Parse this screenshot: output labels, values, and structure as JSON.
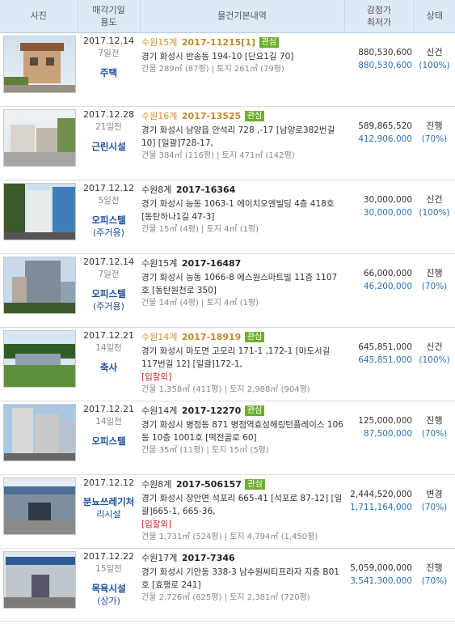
{
  "headers": {
    "photo": "사진",
    "date_line1": "매각기일",
    "date_line2": "용도",
    "info": "물건기본내역",
    "price_line1": "감정가",
    "price_line2": "최저가",
    "status": "상태"
  },
  "colors": {
    "header_bg": "#dde9f5",
    "interest_badge": "#6fae2f",
    "case_highlight": "#c28a2a",
    "use_blue": "#1a4fa0",
    "min_price_blue": "#2a72b8",
    "warning_red": "#d42020"
  },
  "rows": [
    {
      "date": "2017.12.14",
      "days": "7일전",
      "use": "주택",
      "use2": "",
      "court": "수원15계",
      "case_no": "2017-11215[1]",
      "highlight": true,
      "badge": "관심",
      "address": "경기 화성시 반송동 194-10 [단요1길 70]",
      "tag": "",
      "building": "건물 289㎡ (87평) | 토지 261㎡ (79평)",
      "appraisal": "880,530,600",
      "minimum": "880,530,600",
      "status": "신건",
      "ratio": "(100%)",
      "photo_icon": "house-photo"
    },
    {
      "date": "2017.12.28",
      "days": "21일전",
      "use": "근린시설",
      "use2": "",
      "court": "수원16계",
      "case_no": "2017-13525",
      "highlight": true,
      "badge": "관심",
      "address": "경기 화성시 남양읍 안석리 728 ,-17 [남양로382번길 10] [일괄]728-17,",
      "tag": "",
      "building": "건물 384㎡ (116평) | 토지 471㎡ (142평)",
      "appraisal": "589,865,520",
      "minimum": "412,906,000",
      "status": "진행",
      "ratio": "(70%)",
      "photo_icon": "street-photo"
    },
    {
      "date": "2017.12.12",
      "days": "5일전",
      "use": "오피스텔",
      "use2": "(주거용)",
      "court": "수원8계",
      "case_no": "2017-16364",
      "highlight": false,
      "badge": "",
      "address": "경기 화성시 능동 1063-1 에이치오엔빌딩 4층 418호 [동탄하나1길 47-3]",
      "tag": "",
      "building": "건물 15㎡ (4평) | 토지 4㎡ (1평)",
      "appraisal": "30,000,000",
      "minimum": "30,000,000",
      "status": "신건",
      "ratio": "(100%)",
      "photo_icon": "office-photo"
    },
    {
      "date": "2017.12.14",
      "days": "7일전",
      "use": "오피스텔",
      "use2": "(주거용)",
      "court": "수원15계",
      "case_no": "2017-16487",
      "highlight": false,
      "badge": "",
      "address": "경기 화성시 능동 1066-8 에스원스마트빌 11층 1107호 [동탄원천로 350]",
      "tag": "",
      "building": "건물 14㎡ (4평) | 토지 4㎡ (1평)",
      "appraisal": "66,000,000",
      "minimum": "46,200,000",
      "status": "진행",
      "ratio": "(70%)",
      "photo_icon": "tower-photo"
    },
    {
      "date": "2017.12.21",
      "days": "14일전",
      "use": "축사",
      "use2": "",
      "court": "수원14계",
      "case_no": "2017-18919",
      "highlight": true,
      "badge": "관심",
      "address": "경기 화성시 마도면 고모리 171-1 ,172-1 [마도서길117번길 12] [일괄]172-1,",
      "tag": "[입찰외]",
      "building": "건물 1,358㎡ (411평) | 토지 2,988㎡ (904평)",
      "appraisal": "645,851,000",
      "minimum": "645,851,000",
      "status": "신건",
      "ratio": "(100%)",
      "photo_icon": "barn-photo"
    },
    {
      "date": "2017.12.21",
      "days": "14일전",
      "use": "오피스텔",
      "use2": "",
      "court": "수원14계",
      "case_no": "2017-12270",
      "highlight": false,
      "badge": "관심",
      "address": "경기 화성시 병점동 871 병점역효성해링턴플레이스 106동 10층 1001호 [떡전골로 60]",
      "tag": "",
      "building": "건물 35㎡ (11평) | 토지 15㎡ (5평)",
      "appraisal": "125,000,000",
      "minimum": "87,500,000",
      "status": "진행",
      "ratio": "(70%)",
      "photo_icon": "apartment-photo"
    },
    {
      "date": "2017.12.12",
      "days": "",
      "use": "분뇨쓰레기처",
      "use2": "리시설",
      "court": "수원8계",
      "case_no": "2017-506157",
      "highlight": false,
      "badge": "관심",
      "address": "경기 화성시 장안면 석포리 665-41 [석포로 87-12] [일괄]665-1, 665-36,",
      "tag": "[입찰외]",
      "building": "건물 1,731㎡ (524평) | 토지 4,794㎡ (1,450평)",
      "appraisal": "2,444,520,000",
      "minimum": "1,711,164,000",
      "status": "변경",
      "ratio": "(70%)",
      "photo_icon": "factory-photo"
    },
    {
      "date": "2017.12.22",
      "days": "15일전",
      "use": "목욕시설",
      "use2": "(상가)",
      "court": "수원17계",
      "case_no": "2017-7346",
      "highlight": false,
      "badge": "",
      "address": "경기 화성시 기안동 338-3 남수원씨티프라자 지층 B01호 [효행로 241]",
      "tag": "",
      "building": "건물 2,726㎡ (825평) | 토지 2,381㎡ (720평)",
      "appraisal": "5,059,000,000",
      "minimum": "3,541,300,000",
      "status": "진행",
      "ratio": "(70%)",
      "photo_icon": "mall-photo"
    }
  ]
}
